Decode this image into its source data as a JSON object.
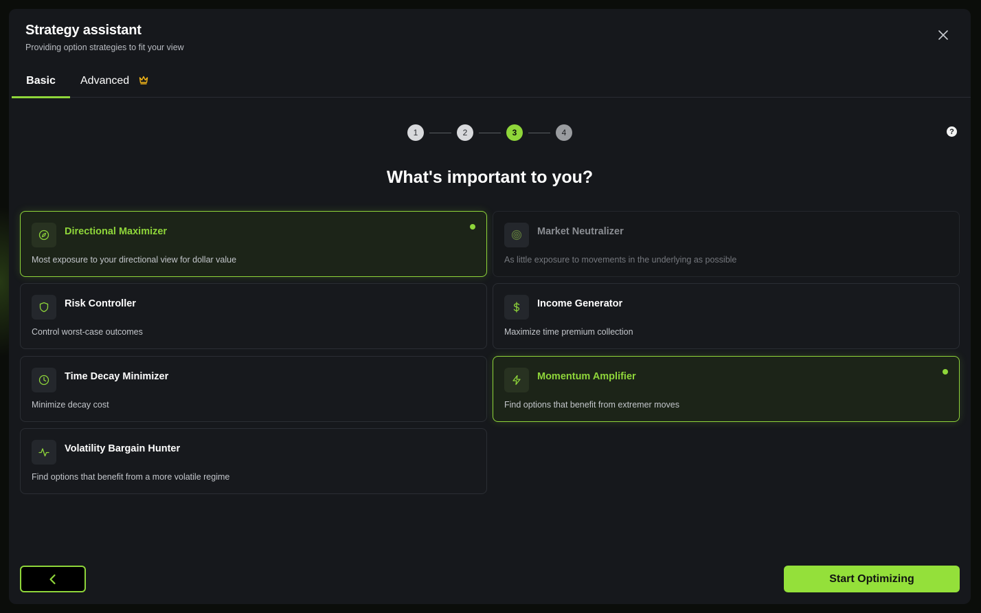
{
  "modal": {
    "title": "Strategy assistant",
    "subtitle": "Providing option strategies to fit your view"
  },
  "tabs": [
    {
      "label": "Basic",
      "active": true
    },
    {
      "label": "Advanced",
      "active": false,
      "icon": "crown-icon"
    }
  ],
  "stepper": {
    "steps": [
      "1",
      "2",
      "3",
      "4"
    ],
    "current": 3
  },
  "question": "What's important to you?",
  "options": [
    {
      "title": "Directional Maximizer",
      "description": "Most exposure to your directional view for dollar value",
      "icon": "compass-icon",
      "selected": true
    },
    {
      "title": "Market Neutralizer",
      "description": "As little exposure to movements in the underlying as possible",
      "icon": "target-icon",
      "selected": false,
      "disabled": true
    },
    {
      "title": "Risk Controller",
      "description": "Control worst-case outcomes",
      "icon": "shield-icon",
      "selected": false
    },
    {
      "title": "Income Generator",
      "description": "Maximize time premium collection",
      "icon": "dollar-icon",
      "selected": false
    },
    {
      "title": "Time Decay Minimizer",
      "description": "Minimize decay cost",
      "icon": "clock-icon",
      "selected": false
    },
    {
      "title": "Momentum Amplifier",
      "description": "Find options that benefit from extremer moves",
      "icon": "lightning-icon",
      "selected": true
    },
    {
      "title": "Volatility Bargain Hunter",
      "description": "Find options that benefit from a more volatile regime",
      "icon": "pulse-icon",
      "selected": false
    }
  ],
  "footer": {
    "start_label": "Start Optimizing"
  },
  "colors": {
    "accent": "#8fd63a",
    "background": "#16181c",
    "crown": "#f2b418"
  }
}
